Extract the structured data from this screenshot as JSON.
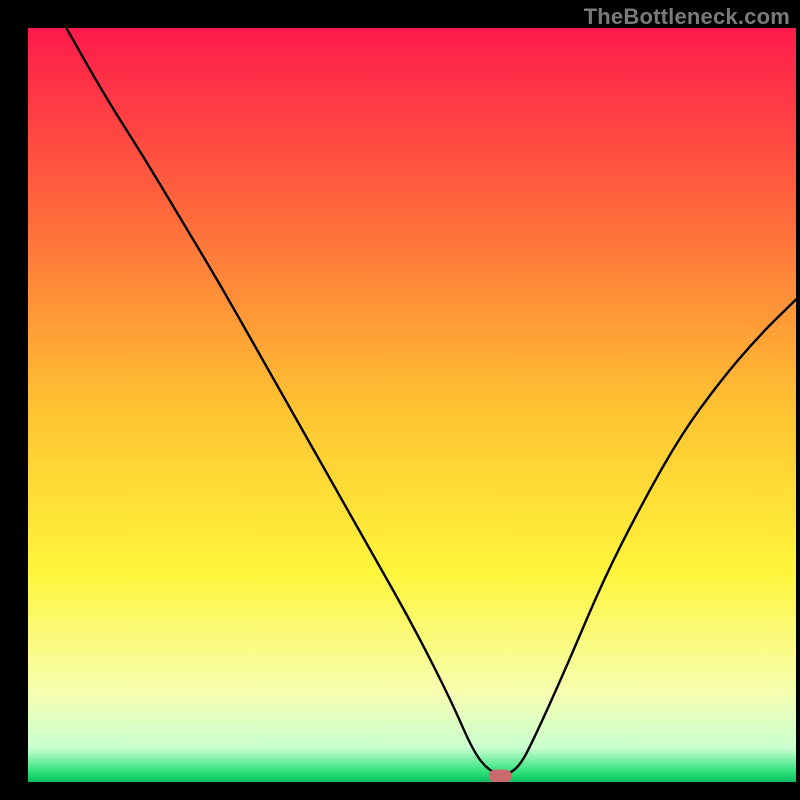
{
  "watermark": "TheBottleneck.com",
  "chart_data": {
    "type": "line",
    "title": "",
    "xlabel": "",
    "ylabel": "",
    "xlim": [
      0,
      100
    ],
    "ylim": [
      0,
      100
    ],
    "grid": false,
    "background_gradient": {
      "stops": [
        {
          "offset": 0.0,
          "color": "#ff1a4b"
        },
        {
          "offset": 0.25,
          "color": "#ff6a3c"
        },
        {
          "offset": 0.5,
          "color": "#ffc232"
        },
        {
          "offset": 0.72,
          "color": "#fff53a"
        },
        {
          "offset": 0.88,
          "color": "#f7ffb0"
        },
        {
          "offset": 0.955,
          "color": "#c9ffd0"
        },
        {
          "offset": 0.985,
          "color": "#35e47e"
        },
        {
          "offset": 1.0,
          "color": "#08c05c"
        }
      ]
    },
    "series": [
      {
        "name": "bottleneck-curve",
        "color": "#000000",
        "x": [
          5,
          10,
          15,
          20,
          25,
          30,
          35,
          40,
          45,
          50,
          55,
          58,
          60,
          62,
          64,
          66,
          70,
          75,
          80,
          85,
          90,
          95,
          100
        ],
        "values": [
          100,
          91,
          83,
          74.5,
          66,
          57,
          48,
          39,
          30,
          21,
          11,
          4,
          1.5,
          0.8,
          2,
          6,
          15,
          27,
          37,
          46,
          53,
          59,
          64
        ]
      }
    ],
    "marker": {
      "x": 61.5,
      "y": 0.8,
      "color": "#c96a6f",
      "shape": "capsule"
    },
    "frame": {
      "left": 3.5,
      "right": 100,
      "inner_color": "transparent",
      "border": "#000000"
    },
    "legend": null,
    "annotations": []
  }
}
